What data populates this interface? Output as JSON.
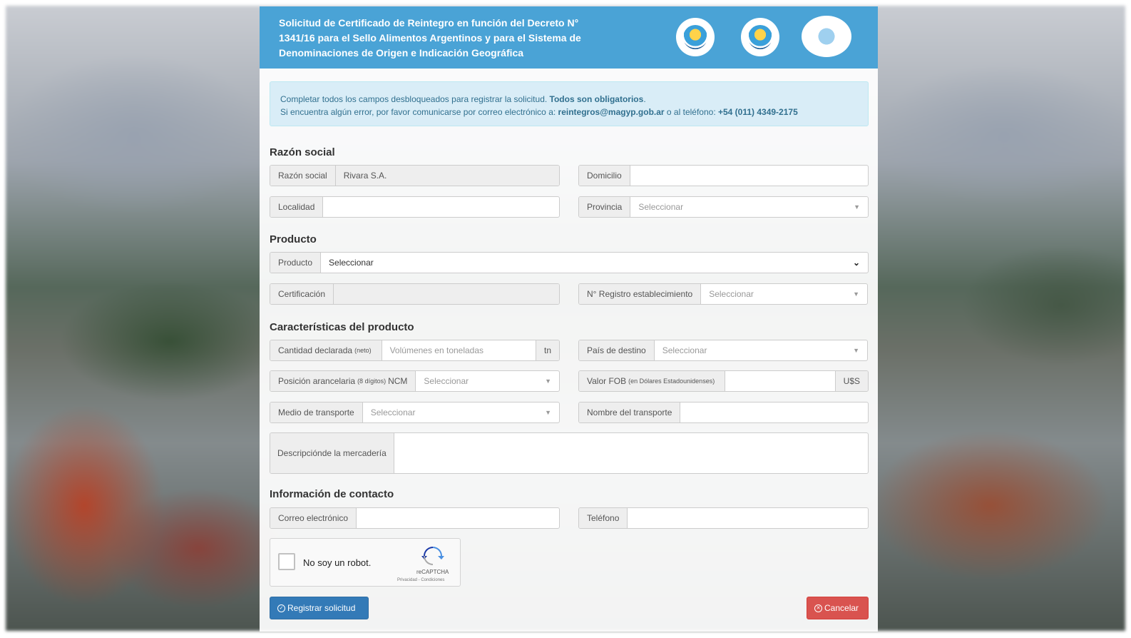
{
  "header": {
    "title": "Solicitud de Certificado de Reintegro en función del Decreto N° 1341/16 para el Sello Alimentos Argentinos y para el Sistema de Denominaciones de Origen e Indicación Geográfica"
  },
  "alert": {
    "line1_text": "Completar todos los campos desbloqueados para registrar la solicitud. ",
    "line1_bold": "Todos son obligatorios",
    "line1_end": ".",
    "line2_text": "Si encuentra algún error, por favor comunicarse por correo electrónico a: ",
    "email": "reintegros@magyp.gob.ar",
    "line2_mid": " o al teléfono: ",
    "phone": "+54 (011) 4349-2175"
  },
  "sections": {
    "razon": "Razón social",
    "producto": "Producto",
    "caracteristicas": "Características del producto",
    "contacto": "Información de contacto"
  },
  "fields": {
    "razon_social": {
      "label": "Razón social",
      "value": "Rivara S.A."
    },
    "domicilio": {
      "label": "Domicilio",
      "value": ""
    },
    "localidad": {
      "label": "Localidad",
      "value": ""
    },
    "provincia": {
      "label": "Provincia",
      "placeholder": "Seleccionar"
    },
    "producto": {
      "label": "Producto",
      "value": "Seleccionar"
    },
    "certificacion": {
      "label": "Certificación",
      "value": ""
    },
    "registro": {
      "label": "N° Registro establecimiento",
      "placeholder": "Seleccionar"
    },
    "cantidad": {
      "label": "Cantidad declarada",
      "small": "(neto)",
      "placeholder": "Volúmenes en toneladas",
      "unit": "tn"
    },
    "pais": {
      "label": "País de destino",
      "placeholder": "Seleccionar"
    },
    "posicion": {
      "label": "Posición arancelaria",
      "small": "(8 dígitos)",
      "label_end": "NCM",
      "placeholder": "Seleccionar"
    },
    "fob": {
      "label": "Valor FOB",
      "small": "(en Dólares Estadounidenses)",
      "unit": "U$S"
    },
    "medio": {
      "label": "Medio de transporte",
      "placeholder": "Seleccionar"
    },
    "nombre_transporte": {
      "label": "Nombre del transporte",
      "value": ""
    },
    "descripcion": {
      "label_line1": "Descripción",
      "label_line2": "de la mercadería"
    },
    "correo": {
      "label": "Correo electrónico",
      "value": ""
    },
    "telefono": {
      "label": "Teléfono",
      "value": ""
    }
  },
  "captcha": {
    "label": "No soy un robot.",
    "brand": "reCAPTCHA",
    "links": "Privacidad - Condiciones"
  },
  "buttons": {
    "submit": "Registrar solicitud",
    "cancel": "Cancelar"
  },
  "icons": {
    "submit": "check-circle-icon",
    "cancel": "times-circle-icon",
    "select": "caret-down-icon",
    "dropdown": "chevron-down-icon"
  },
  "colors": {
    "header": "#4aa3d6",
    "alert_bg": "#d9edf7",
    "primary": "#337ab7",
    "danger": "#d9534f"
  }
}
